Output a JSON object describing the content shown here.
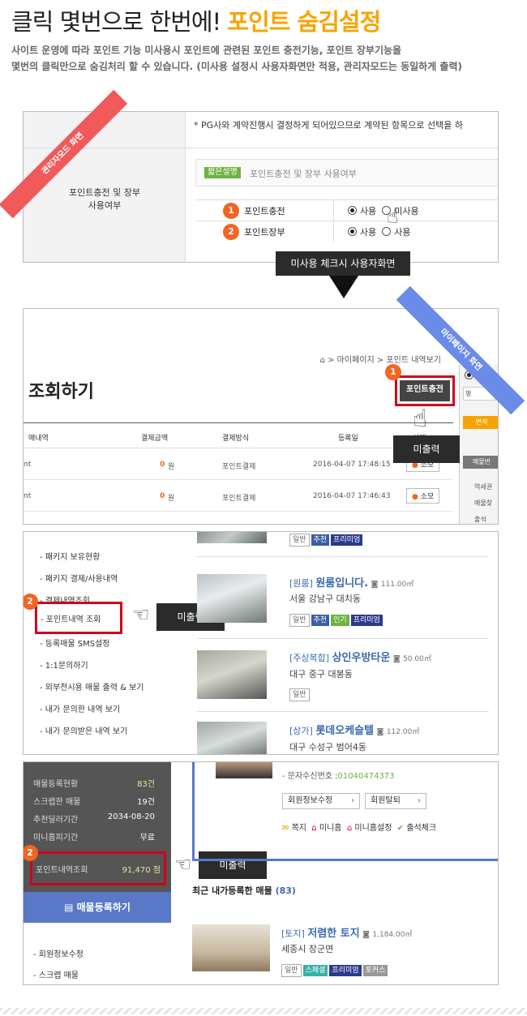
{
  "hero": {
    "title_plain": "클릭 몇번으로 한번에!",
    "title_highlight": "포인트 숨김설정",
    "desc_line1": "사이트 운영에 따라 포인트 기능 미사용시 포인트에 관련된 포인트 충전기능, 포인트 장부기능을",
    "desc_line2": "몇번의 클릭만으로 숨김처리 할 수 있습니다. (미사용 설정시 사용자화면만 적용, 관리자모드는 동일하게 출력)"
  },
  "admin": {
    "ribbon": "관리자모드 화면",
    "notice": "* PG사와 계약진행시 결정하게 되어있으므로 계약된 항목으로 선택을 하",
    "row_label_1": "포인트충전 및 장부",
    "row_label_2": "사용여부",
    "tag": "짧은설명",
    "tag_desc": "포인트충전 및 장부 사용여부",
    "items": [
      {
        "num": "1",
        "label": "포인트충전",
        "use": "사용",
        "unused": "미사용"
      },
      {
        "num": "2",
        "label": "포인트장부",
        "use": "사용",
        "unused": "사용"
      }
    ],
    "arrow_label": "미사용 체크시 사용자화면"
  },
  "mypage": {
    "ribbon": "마이페이지 화면",
    "breadcrumb": "> 마이페이지 > 포인트 내역보기",
    "title": "조회하기",
    "charge_button": "포인트충전",
    "num": "1",
    "tip": "미출력",
    "columns": [
      "매내역",
      "결제금액",
      "결제방식",
      "등록일",
      "상태"
    ],
    "rows": [
      {
        "name": "nt",
        "amount": "0",
        "unit": "원",
        "method": "포인트결제",
        "date": "2016-04-07 17:48:15",
        "status": "소모"
      },
      {
        "name": "nt",
        "amount": "0",
        "unit": "원",
        "method": "포인트결제",
        "date": "2016-04-07 17:46:43",
        "status": "소모"
      }
    ],
    "side": {
      "label1": "평",
      "label2": "m²",
      "btn": "면적",
      "side1": "매물번",
      "side2": "역세권",
      "side3": "매물찾",
      "side4": "출석"
    }
  },
  "menu": {
    "items": [
      "패키지 보유현황",
      "패키지 결제/사용내역",
      "결제내역조회",
      "포인트내역 조회",
      "등록매물 SMS설정",
      "1:1문의하기",
      "외부전시용 매물 출력 & 보기",
      "내가 문의한 내역 보기",
      "내가 문의받은 내역 보기"
    ],
    "num": "2",
    "tip": "미출력",
    "listings": [
      {
        "category": "[원룸]",
        "name": "원룸입니다.",
        "area": "111.00㎡",
        "address": "서울 강남구 대치동",
        "tags": [
          "일반",
          "추천",
          "인기",
          "프리미엄"
        ]
      },
      {
        "category": "[주상복합]",
        "name": "상인우방타운",
        "area": "50.00㎡",
        "address": "대구 중구 대봉동",
        "tags": [
          "일반"
        ]
      },
      {
        "category": "[상가]",
        "name": "롯데오케슬텔",
        "area": "112.00㎡",
        "address": "대구 수성구 범어4동",
        "tags": []
      }
    ],
    "top_tags": [
      "일반",
      "추천",
      "프리미엄"
    ]
  },
  "member": {
    "stats": [
      {
        "label": "매물등록현황",
        "value": "83건"
      },
      {
        "label": "스크랩한 매물",
        "value": "19건"
      },
      {
        "label": "추천딜러기간",
        "value": "2034-08-20"
      },
      {
        "label": "미니홈피기간",
        "value": "무료"
      }
    ],
    "point_label": "포인트내역조회",
    "point_value": "91,470 점",
    "register_btn": "매물등록하기",
    "links": [
      "회원정보수정",
      "스크랩 매물"
    ],
    "num": "2",
    "tip": "미출력",
    "phone_label": "- 문자수신번호 :",
    "phone": "01040474373",
    "btn_edit": "회원정보수정",
    "btn_leave": "회원탈퇴",
    "icons": [
      "쪽지",
      "미니홈",
      "미니홈설정",
      "출석체크"
    ],
    "recent_title": "최근 내가등록한 매물",
    "recent_count": "(83)",
    "recent": {
      "category": "[토지]",
      "name": "저렴한 토지",
      "area": "1,184.00㎡",
      "address": "세종시 장군면",
      "tags": [
        "일반",
        "스페셜",
        "프리미엄",
        "포커스"
      ]
    }
  }
}
